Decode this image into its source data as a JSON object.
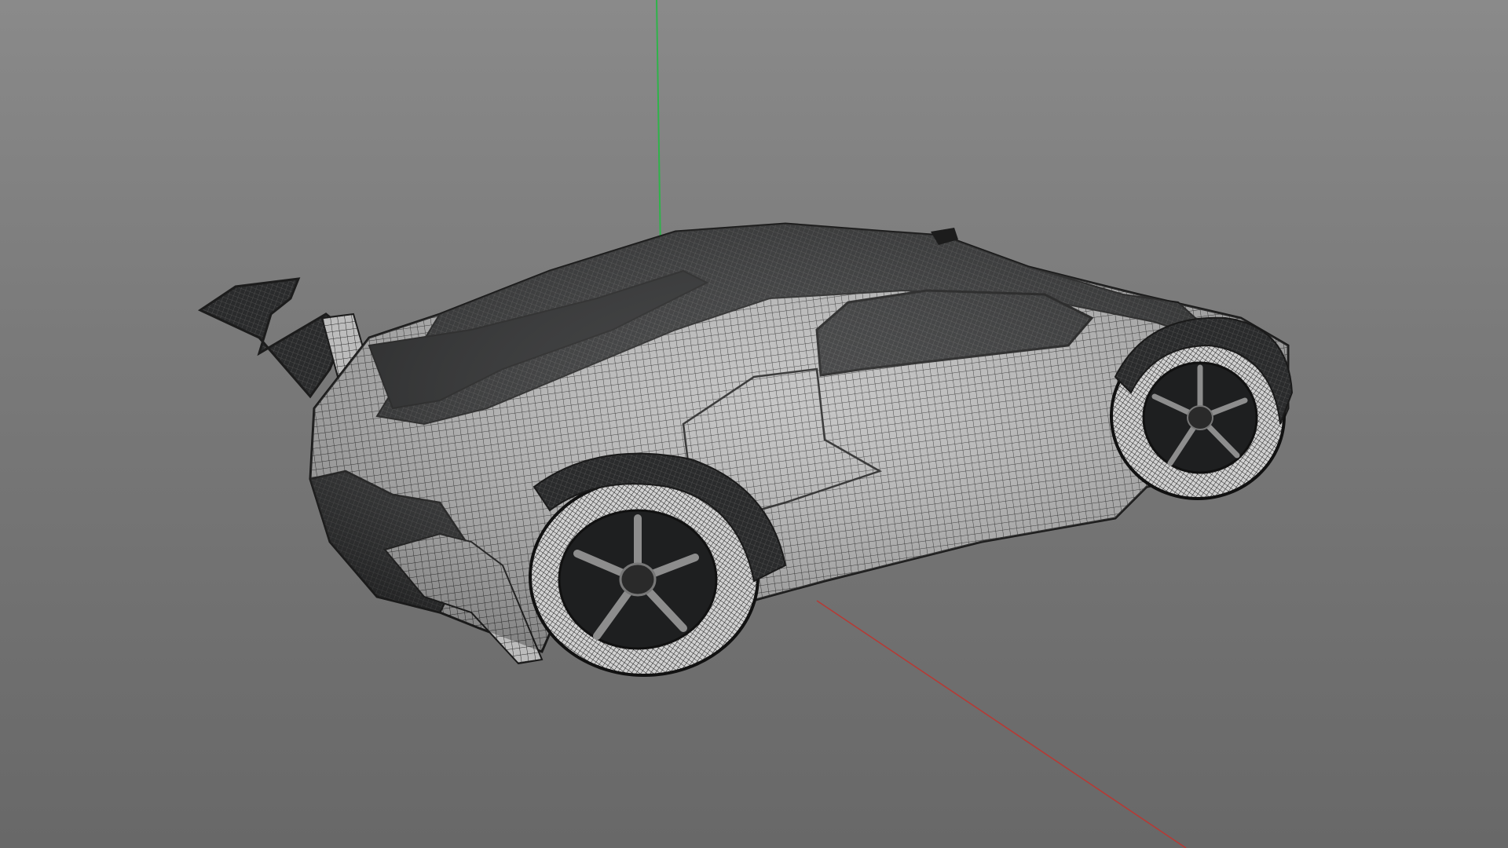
{
  "viewport": {
    "background_top": "#8a8a8a",
    "background_bottom": "#686868",
    "axis_colors": {
      "y_axis": "#2fb34a",
      "x_axis": "#b63a35"
    },
    "wireframe_color": "#262829",
    "wireframe_light": "#c9c9c9"
  },
  "model": {
    "icon": "wireframe-car-model"
  }
}
